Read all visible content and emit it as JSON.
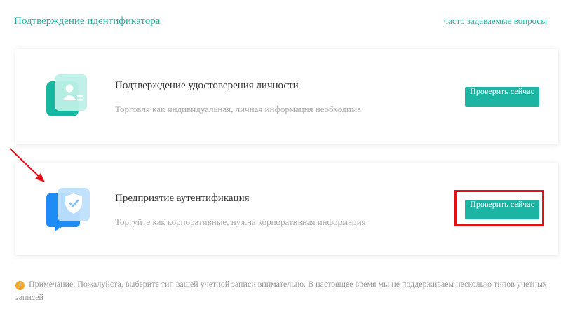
{
  "header": {
    "title": "Подтверждение идентификатора",
    "faq_link": "часто задаваемые вопросы"
  },
  "cards": [
    {
      "title": "Подтверждение удостоверения личности",
      "description": "Торговля как индивидуальная, личная информация необходима",
      "button_label": "Проверить сейчас",
      "icon": "id-card-icon"
    },
    {
      "title": "Предприятие аутентификация",
      "description": "Торгуйте как корпоративные, нужна корпоративная информация",
      "button_label": "Проверить сейчас",
      "icon": "shield-check-icon"
    }
  ],
  "note": {
    "icon": "info-icon",
    "text": "Примечание. Пожалуйста, выберите тип вашей учетной записи внимательно. В настоящее время мы не поддерживаем несколько типов учетных записей"
  },
  "colors": {
    "accent": "#1cb4a3",
    "enterprise_icon": "#1e8cf5",
    "highlight": "#e30f17",
    "note_icon": "#f5a623"
  }
}
